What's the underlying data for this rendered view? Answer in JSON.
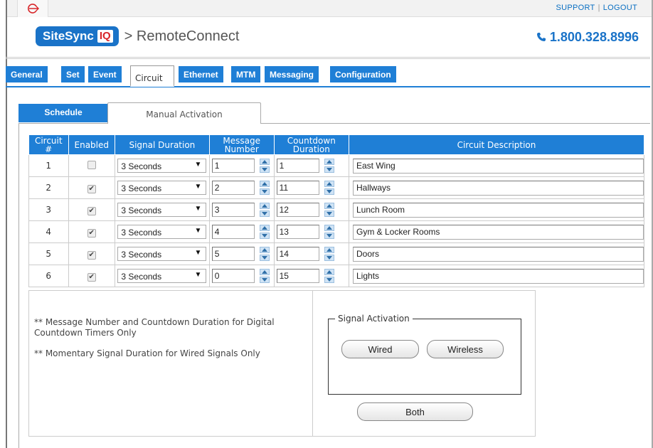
{
  "top_links": {
    "support": "SUPPORT",
    "separator": "|",
    "logout": "LOGOUT"
  },
  "header": {
    "brand_text": "SiteSync",
    "brand_badge": "IQ",
    "title_separator": ">",
    "app_title": "RemoteConnect",
    "phone": "1.800.328.8996",
    "phone_icon": "phone-icon",
    "logo_icon": "red-circle-arrow-icon"
  },
  "main_tabs": [
    {
      "label": "General",
      "active": false
    },
    {
      "label": "Set",
      "active": false
    },
    {
      "label": "Event",
      "active": false
    },
    {
      "label": "Circuit",
      "active": true
    },
    {
      "label": "Ethernet",
      "active": false
    },
    {
      "label": "MTM",
      "active": false
    },
    {
      "label": "Messaging",
      "active": false
    },
    {
      "label": "Configuration",
      "active": false
    }
  ],
  "sub_tabs": [
    {
      "label": "Schedule",
      "active": false
    },
    {
      "label": "Manual Activation",
      "active": true
    }
  ],
  "table": {
    "headers": {
      "circuit_line1": "Circuit",
      "circuit_line2": "#",
      "enabled": "Enabled",
      "signal_duration": "Signal Duration",
      "message_line1": "Message",
      "message_line2": "Number",
      "countdown_line1": "Countdown",
      "countdown_line2": "Duration",
      "description": "Circuit Description"
    },
    "rows": [
      {
        "circuit": "1",
        "enabled": false,
        "duration": "3 Seconds",
        "message": "1",
        "countdown": "1",
        "description": "East Wing"
      },
      {
        "circuit": "2",
        "enabled": true,
        "duration": "3 Seconds",
        "message": "2",
        "countdown": "11",
        "description": "Hallways"
      },
      {
        "circuit": "3",
        "enabled": true,
        "duration": "3 Seconds",
        "message": "3",
        "countdown": "12",
        "description": "Lunch Room"
      },
      {
        "circuit": "4",
        "enabled": true,
        "duration": "3 Seconds",
        "message": "4",
        "countdown": "13",
        "description": "Gym & Locker Rooms"
      },
      {
        "circuit": "5",
        "enabled": true,
        "duration": "3 Seconds",
        "message": "5",
        "countdown": "14",
        "description": "Doors"
      },
      {
        "circuit": "6",
        "enabled": true,
        "duration": "3 Seconds",
        "message": "0",
        "countdown": "15",
        "description": "Lights"
      }
    ]
  },
  "notes": {
    "note1": "** Message Number and Countdown Duration for Digital Countdown Timers Only",
    "note2": "** Momentary Signal Duration for Wired Signals Only"
  },
  "signal_activation": {
    "legend": "Signal Activation",
    "wired_label": "Wired",
    "wireless_label": "Wireless",
    "both_label": "Both"
  },
  "colors": {
    "accent": "#1f7fd6",
    "brand_red": "#d8262a"
  }
}
